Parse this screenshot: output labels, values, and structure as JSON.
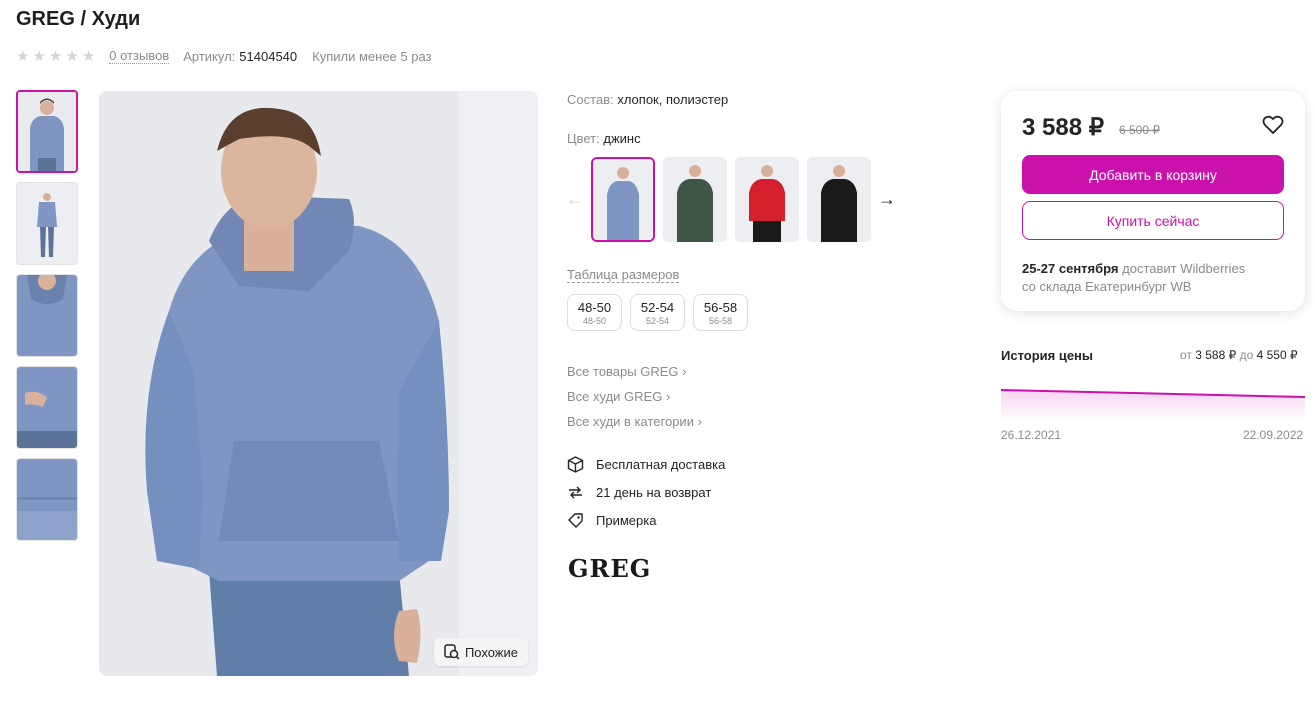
{
  "product": {
    "title": "GREG / Худи",
    "reviews": "0 отзывов",
    "article_label": "Артикул:",
    "article": "51404540",
    "bought": "Купили менее 5 раз",
    "rating_stars": 0
  },
  "gallery": {
    "similar_label": "Похожие"
  },
  "details": {
    "composition_label": "Состав:",
    "composition": "хлопок, полиэстер",
    "color_label": "Цвет:",
    "color": "джинс",
    "swatches": [
      "джинс",
      "зеленый",
      "красный",
      "черный"
    ],
    "size_table": "Таблица размеров",
    "sizes": [
      {
        "main": "48-50",
        "sub": "48-50"
      },
      {
        "main": "52-54",
        "sub": "52-54"
      },
      {
        "main": "56-58",
        "sub": "56-58"
      }
    ],
    "links": [
      "Все товары GREG",
      "Все худи GREG",
      "Все худи в категории"
    ],
    "features": [
      "Бесплатная доставка",
      "21 день на возврат",
      "Примерка"
    ],
    "brand_logo": "GREG"
  },
  "buybox": {
    "price": "3 588 ₽",
    "old_price": "6 500 ₽",
    "add_to_cart": "Добавить в корзину",
    "buy_now": "Купить сейчас",
    "delivery_date": "25-27 сентября",
    "delivery_text": "доставит Wildberries",
    "delivery_from": "со склада Екатеринбург WB"
  },
  "price_history": {
    "title": "История цены",
    "from_label": "от",
    "min": "3 588 ₽",
    "to_label": "до",
    "max": "4 550 ₽",
    "start_date": "26.12.2021",
    "end_date": "22.09.2022"
  },
  "colors": {
    "accent": "#cb11ab",
    "denim": "#7f96c4",
    "green": "#3f5647",
    "red": "#d4202c",
    "black": "#1a1a1a"
  }
}
